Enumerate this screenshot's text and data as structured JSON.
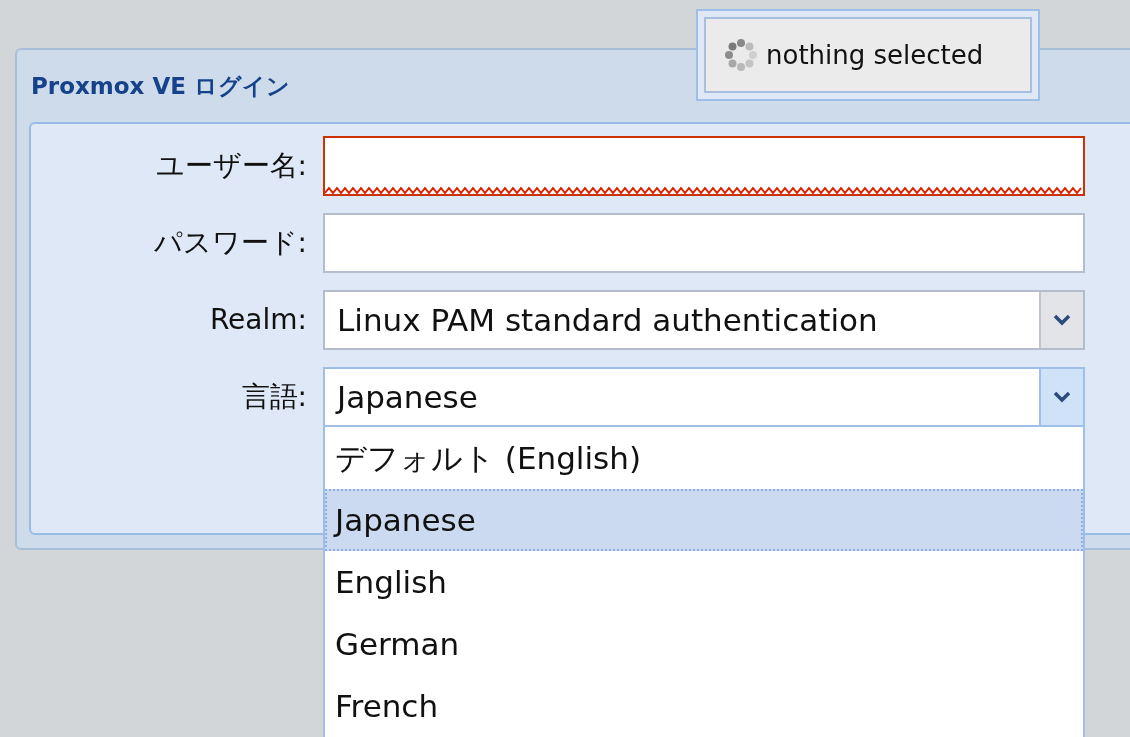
{
  "window": {
    "title": "Proxmox VE ログイン"
  },
  "fields": [
    {
      "kind": "text",
      "label": "ユーザー名:",
      "invalid": true
    },
    {
      "kind": "password",
      "label": "パスワード:",
      "invalid": false
    },
    {
      "kind": "select",
      "label": "Realm:",
      "value": "Linux PAM standard authentication",
      "open": false
    },
    {
      "kind": "select",
      "label": "言語:",
      "value": "Japanese",
      "open": true
    }
  ],
  "dropdown": {
    "options": [
      {
        "label": "デフォルト (English)",
        "selected": false
      },
      {
        "label": "Japanese",
        "selected": true
      },
      {
        "label": "English",
        "selected": false
      },
      {
        "label": "German",
        "selected": false
      },
      {
        "label": "French",
        "selected": false
      }
    ]
  },
  "toast": {
    "text": "nothing selected"
  }
}
